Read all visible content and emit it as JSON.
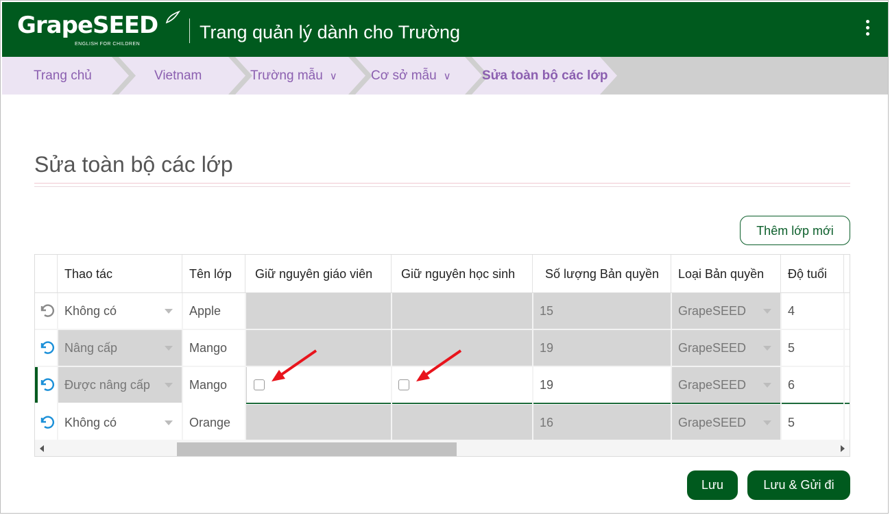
{
  "header": {
    "logo_text": "GrapeSEED",
    "logo_tagline": "ENGLISH FOR CHILDREN",
    "app_title": "Trang quản lý dành cho Trường"
  },
  "breadcrumb": [
    {
      "label": "Trang chủ"
    },
    {
      "label": "Vietnam"
    },
    {
      "label": "Trường mẫu",
      "chevron": "∨"
    },
    {
      "label": "Cơ sở mẫu",
      "chevron": "∨"
    },
    {
      "label": "Sửa toàn bộ các lớp"
    }
  ],
  "page": {
    "title": "Sửa toàn bộ các lớp",
    "add_button": "Thêm lớp mới"
  },
  "table": {
    "columns": [
      "Thao tác",
      "Tên lớp",
      "Giữ nguyên giáo viên",
      "Giữ nguyên học sinh",
      "Số lượng Bản quyền",
      "Loại Bản quyền",
      "Độ tuổi"
    ],
    "rows": [
      {
        "action": "Không có",
        "class_name": "Apple",
        "keep_teacher": null,
        "keep_students": null,
        "licenses": "15",
        "license_type": "GrapeSEED",
        "age": "4",
        "undo_active": false
      },
      {
        "action": "Nâng cấp",
        "class_name": "Mango",
        "keep_teacher": null,
        "keep_students": null,
        "licenses": "19",
        "license_type": "GrapeSEED",
        "age": "5",
        "undo_active": true
      },
      {
        "action": "Được nâng cấp",
        "class_name": "Mango",
        "keep_teacher": false,
        "keep_students": false,
        "licenses": "19",
        "license_type": "GrapeSEED",
        "age": "6",
        "undo_active": true
      },
      {
        "action": "Không có",
        "class_name": "Orange",
        "keep_teacher": null,
        "keep_students": null,
        "licenses": "16",
        "license_type": "GrapeSEED",
        "age": "5",
        "undo_active": true
      }
    ]
  },
  "footer": {
    "save_label": "Lưu",
    "save_send_label": "Lưu & Gửi đi"
  },
  "colors": {
    "brand_green": "#005a1e",
    "breadcrumb_purple": "#8b5fb0",
    "breadcrumb_bg": "#ece4f3",
    "annotation_red": "#e8141c",
    "undo_active": "#1a8fd8"
  }
}
